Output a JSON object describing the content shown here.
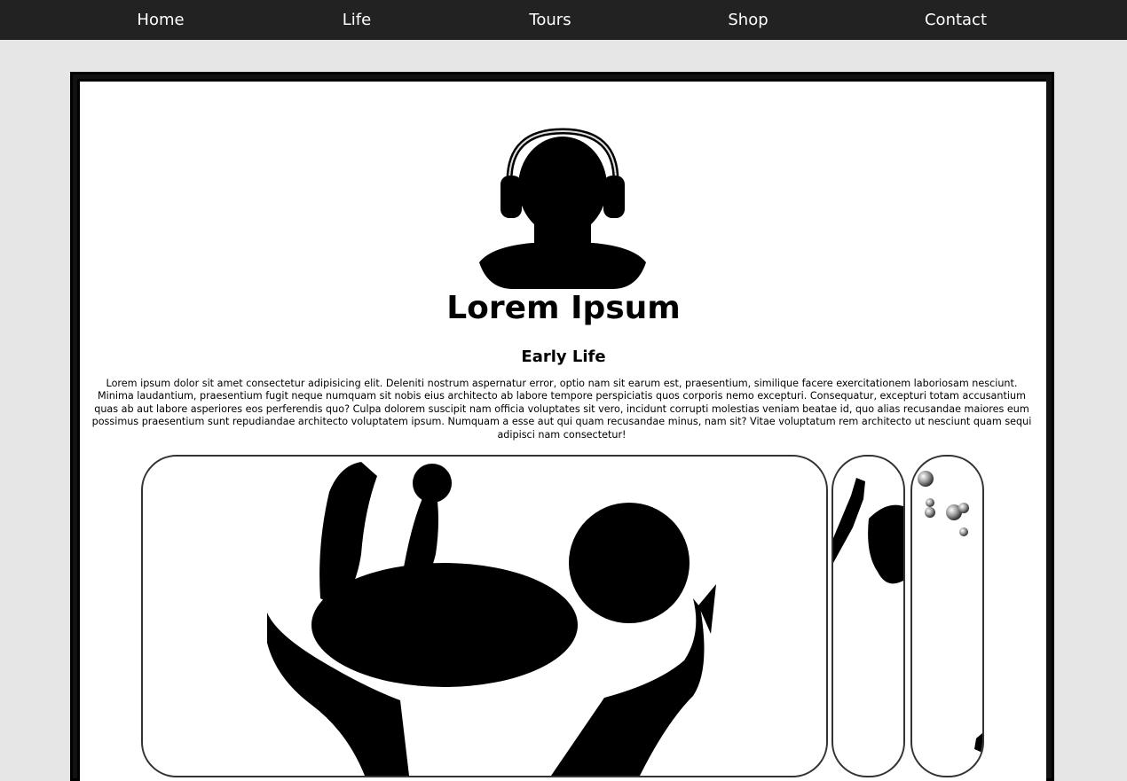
{
  "nav": {
    "items": [
      {
        "label": "Home"
      },
      {
        "label": "Life"
      },
      {
        "label": "Tours"
      },
      {
        "label": "Shop"
      },
      {
        "label": "Contact"
      }
    ]
  },
  "profile": {
    "avatar_icon": "headphones-person-silhouette",
    "name": "Lorem Ipsum"
  },
  "section": {
    "heading": "Early Life",
    "body": "Lorem ipsum dolor sit amet consectetur adipisicing elit. Deleniti nostrum aspernatur error, optio nam sit earum est, praesentium, similique facere exercitationem laboriosam nesciunt. Minima laudantium, praesentium fugit neque numquam sit nobis eius architecto ab labore tempore perspiciatis quos corporis nemo excepturi. Consequatur, excepturi totam accusantium quas ab aut labore asperiores eos perferendis quo? Culpa dolorem suscipit nam officia voluptates sit vero, incidunt corrupti molestias veniam beatae id, quo alias recusandae maiores eum possimus praesentium sunt repudiandae architecto voluptatem ipsum. Numquam a esse aut qui quam recusandae minus, nam sit? Vitae voluptatum rem architecto ut nesciunt quam sequi adipisci nam consectetur!"
  },
  "gallery": {
    "images": [
      "baby-held-in-hands-silhouette",
      "hands-reaching-silhouette",
      "bubbles-image"
    ]
  },
  "colors": {
    "nav_bg": "#222222",
    "page_bg": "#e6e6e6",
    "frame": "#111111",
    "content_bg": "#ffffff"
  }
}
